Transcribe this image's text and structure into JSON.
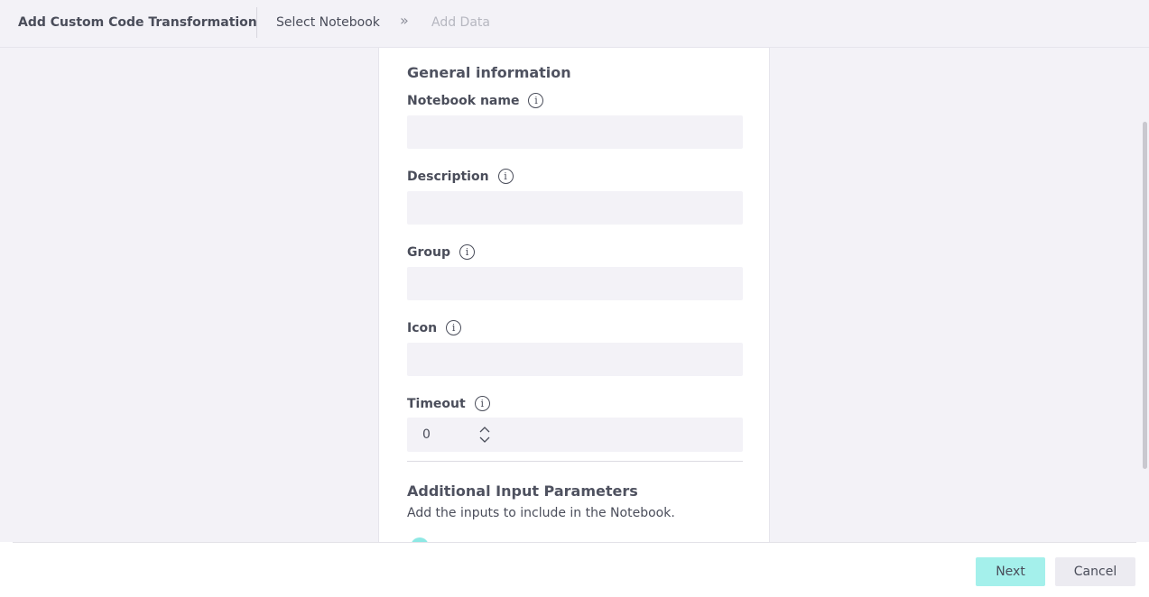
{
  "header": {
    "title": "Add Custom Code Transformation",
    "steps": [
      {
        "label": "Select Notebook",
        "state": "active"
      },
      {
        "label": "Add Data",
        "state": "disabled"
      }
    ],
    "separator_icon": "double-chevron-right-icon"
  },
  "form": {
    "general_title": "General information",
    "fields": {
      "notebook_name": {
        "label": "Notebook name",
        "value": "",
        "placeholder": ""
      },
      "description": {
        "label": "Description",
        "value": "",
        "placeholder": ""
      },
      "group": {
        "label": "Group",
        "value": "",
        "placeholder": ""
      },
      "icon": {
        "label": "Icon",
        "value": "",
        "placeholder": ""
      },
      "timeout": {
        "label": "Timeout",
        "value": "0"
      }
    },
    "info_glyph": "i",
    "additional_title": "Additional Input Parameters",
    "additional_subtitle": "Add the inputs to include in the Notebook."
  },
  "footer": {
    "next_label": "Next",
    "cancel_label": "Cancel"
  },
  "colors": {
    "background": "#f3f2f7",
    "card": "#ffffff",
    "accent": "#a4f0eb",
    "text": "#4a4d5a",
    "disabled_text": "#b6b7c0"
  }
}
